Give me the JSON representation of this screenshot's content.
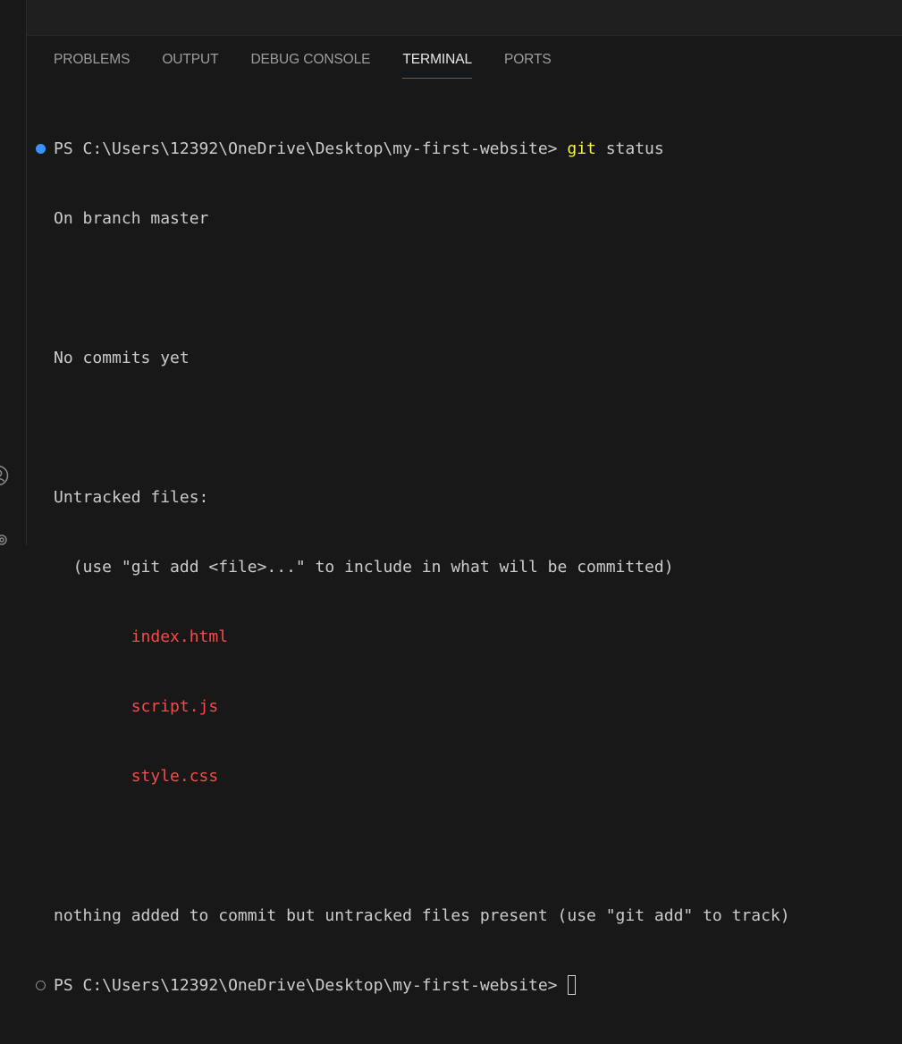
{
  "panel": {
    "tabs": [
      {
        "label": "PROBLEMS",
        "active": false
      },
      {
        "label": "OUTPUT",
        "active": false
      },
      {
        "label": "DEBUG CONSOLE",
        "active": false
      },
      {
        "label": "TERMINAL",
        "active": true
      },
      {
        "label": "PORTS",
        "active": false
      }
    ]
  },
  "terminal": {
    "prompt": "PS C:\\Users\\12392\\OneDrive\\Desktop\\my-first-website> ",
    "command_name": "git",
    "command_args": " status",
    "output": {
      "branch": "On branch master",
      "commits": "No commits yet",
      "untracked_header": "Untracked files:",
      "hint": "  (use \"git add <file>...\" to include in what will be committed)",
      "files": [
        "index.html",
        "script.js",
        "style.css"
      ],
      "summary": "nothing added to commit but untracked files present (use \"git add\" to track)"
    },
    "prompt2": "PS C:\\Users\\12392\\OneDrive\\Desktop\\my-first-website> "
  },
  "colors": {
    "background": "#181818",
    "text": "#cccccc",
    "command": "#f5f543",
    "untracked_file": "#f14c4c",
    "active_tab_underline": "#0078d4",
    "decoration_success": "#3794ff"
  },
  "icons": {
    "account": "account-icon",
    "manage": "gear-icon",
    "command_success": "circle-filled-icon",
    "command_pending": "circle-outline-icon"
  }
}
